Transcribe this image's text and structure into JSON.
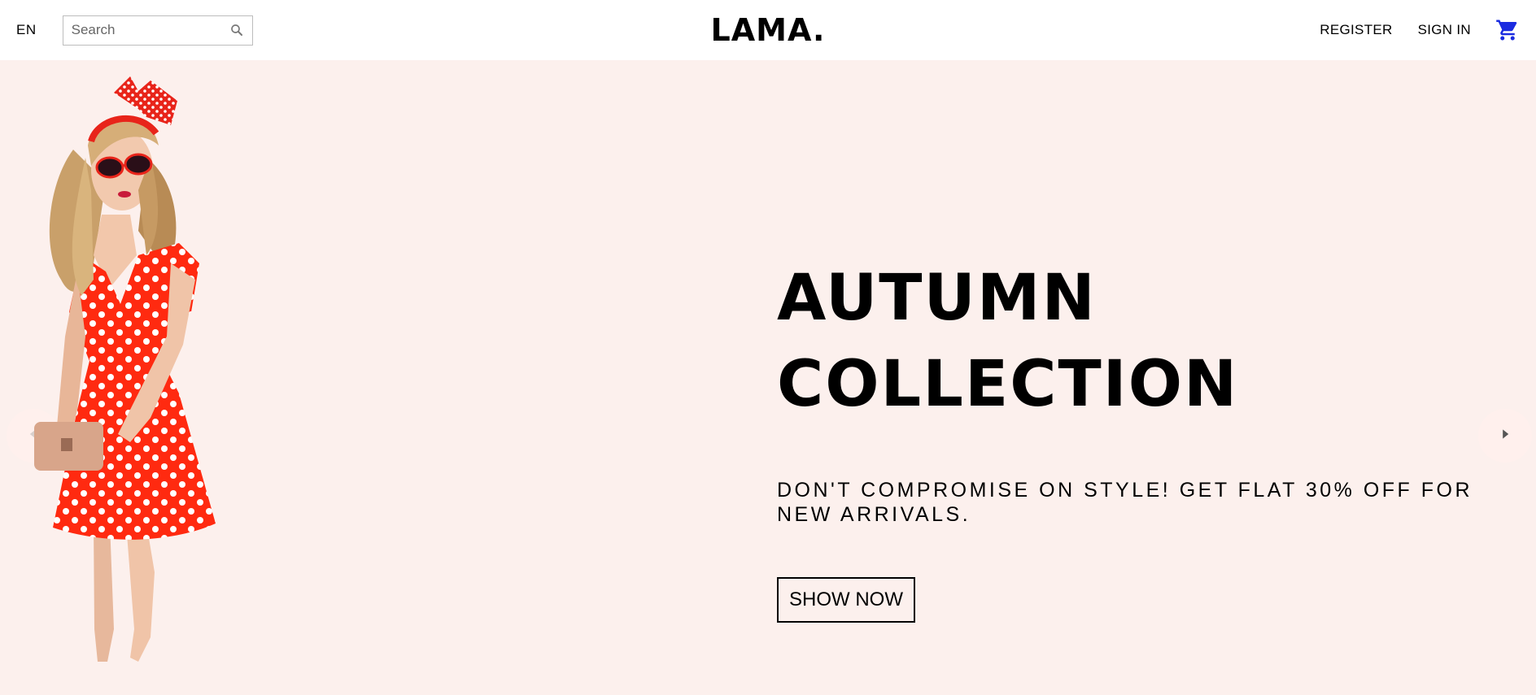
{
  "navbar": {
    "language": "EN",
    "search_placeholder": "Search",
    "logo": "LAMA.",
    "links": {
      "register": "REGISTER",
      "sign_in": "SIGN IN"
    },
    "cart_icon": "shopping-cart-icon",
    "cart_color": "#1a2be0"
  },
  "slide": {
    "background": "#fcf0ed",
    "title_line1": "AUTUMN",
    "title_line2": "COLLECTION",
    "description": "DON'T COMPROMISE ON STYLE! GET FLAT 30% OFF FOR NEW ARRIVALS.",
    "button": "SHOW NOW",
    "prev_icon": "arrow-left-icon",
    "next_icon": "arrow-right-icon",
    "image": "woman-in-red-polka-dot-dress"
  }
}
